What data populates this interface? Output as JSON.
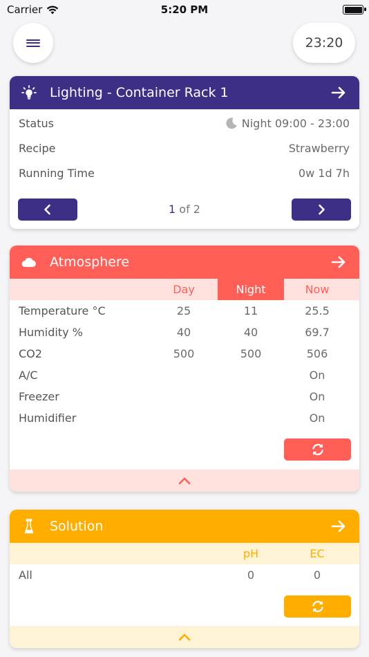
{
  "status_bar": {
    "carrier": "Carrier",
    "time": "5:20 PM",
    "battery_level": 1.0
  },
  "header": {
    "clock": "23:20"
  },
  "lighting": {
    "title": "Lighting - Container Rack 1",
    "rows": [
      {
        "key": "Status",
        "value": "Night 09:00 - 23:00",
        "icon": "moon-icon"
      },
      {
        "key": "Recipe",
        "value": "Strawberry"
      },
      {
        "key": "Running Time",
        "value": "0w 1d 7h"
      }
    ],
    "pager": {
      "current": "1",
      "of": "of 2"
    },
    "accent": "#3d2f86"
  },
  "atmosphere": {
    "title": "Atmosphere",
    "columns": [
      "Day",
      "Night",
      "Now"
    ],
    "active_column": "Night",
    "rows": [
      {
        "label": "Temperature °C",
        "day": "25",
        "night": "11",
        "now": "25.5"
      },
      {
        "label": "Humidity %",
        "day": "40",
        "night": "40",
        "now": "69.7"
      },
      {
        "label": "CO2",
        "day": "500",
        "night": "500",
        "now": "506"
      },
      {
        "label": "A/C",
        "day": "",
        "night": "",
        "now": "On"
      },
      {
        "label": "Freezer",
        "day": "",
        "night": "",
        "now": "On"
      },
      {
        "label": "Humidifier",
        "day": "",
        "night": "",
        "now": "On"
      }
    ],
    "accent": "#ff5f57"
  },
  "solution": {
    "title": "Solution",
    "columns": [
      "pH",
      "EC"
    ],
    "rows": [
      {
        "label": "All",
        "ph": "0",
        "ec": "0"
      }
    ],
    "accent": "#ffae00"
  }
}
